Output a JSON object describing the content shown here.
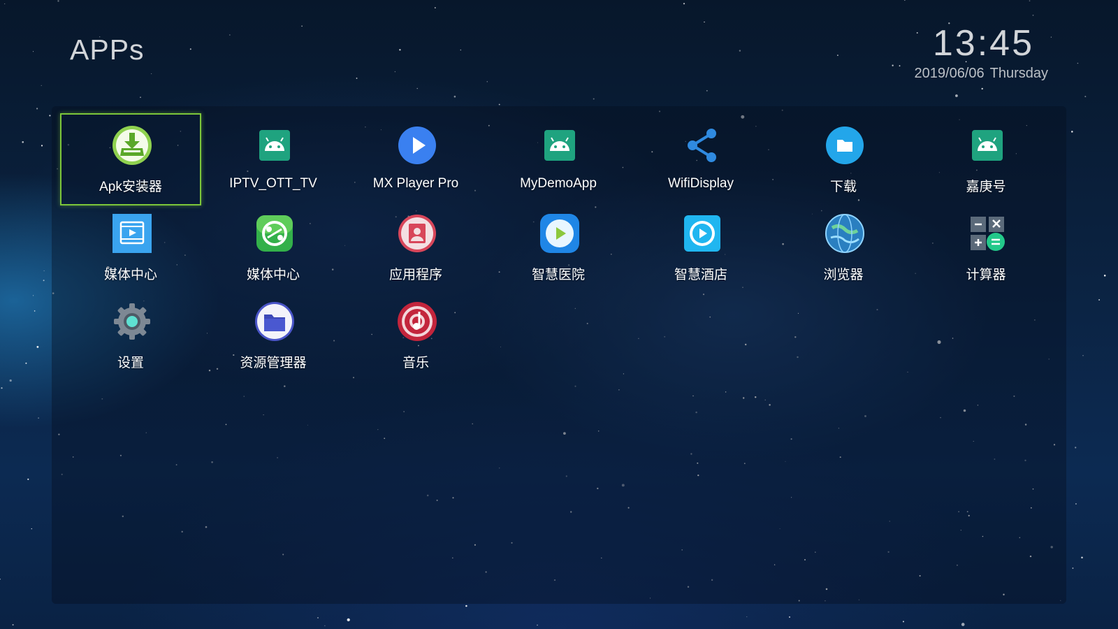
{
  "header": {
    "title": "APPs",
    "time": "13:45",
    "date": "2019/06/06",
    "weekday": "Thursday"
  },
  "focused_index": 0,
  "apps": [
    {
      "label": "Apk安装器",
      "icon": "apk-installer-icon"
    },
    {
      "label": "IPTV_OTT_TV",
      "icon": "android-icon"
    },
    {
      "label": "MX Player Pro",
      "icon": "play-icon"
    },
    {
      "label": "MyDemoApp",
      "icon": "android-icon"
    },
    {
      "label": "WifiDisplay",
      "icon": "share-icon"
    },
    {
      "label": "下载",
      "icon": "folder-icon"
    },
    {
      "label": "嘉庚号",
      "icon": "android-icon"
    },
    {
      "label": "媒体中心",
      "icon": "media-center-icon"
    },
    {
      "label": "媒体中心",
      "icon": "media-sync-icon"
    },
    {
      "label": "应用程序",
      "icon": "app-store-icon"
    },
    {
      "label": "智慧医院",
      "icon": "smart-hospital-icon"
    },
    {
      "label": "智慧酒店",
      "icon": "smart-hotel-icon"
    },
    {
      "label": "浏览器",
      "icon": "browser-globe-icon"
    },
    {
      "label": "计算器",
      "icon": "calculator-icon"
    },
    {
      "label": "设置",
      "icon": "settings-gear-icon"
    },
    {
      "label": "资源管理器",
      "icon": "file-manager-icon"
    },
    {
      "label": "音乐",
      "icon": "music-icon"
    }
  ],
  "colors": {
    "focus_border": "#7cc63a",
    "android_green": "#1fa37f",
    "play_blue": "#3a80f0",
    "folder_blue": "#23a6ea"
  }
}
